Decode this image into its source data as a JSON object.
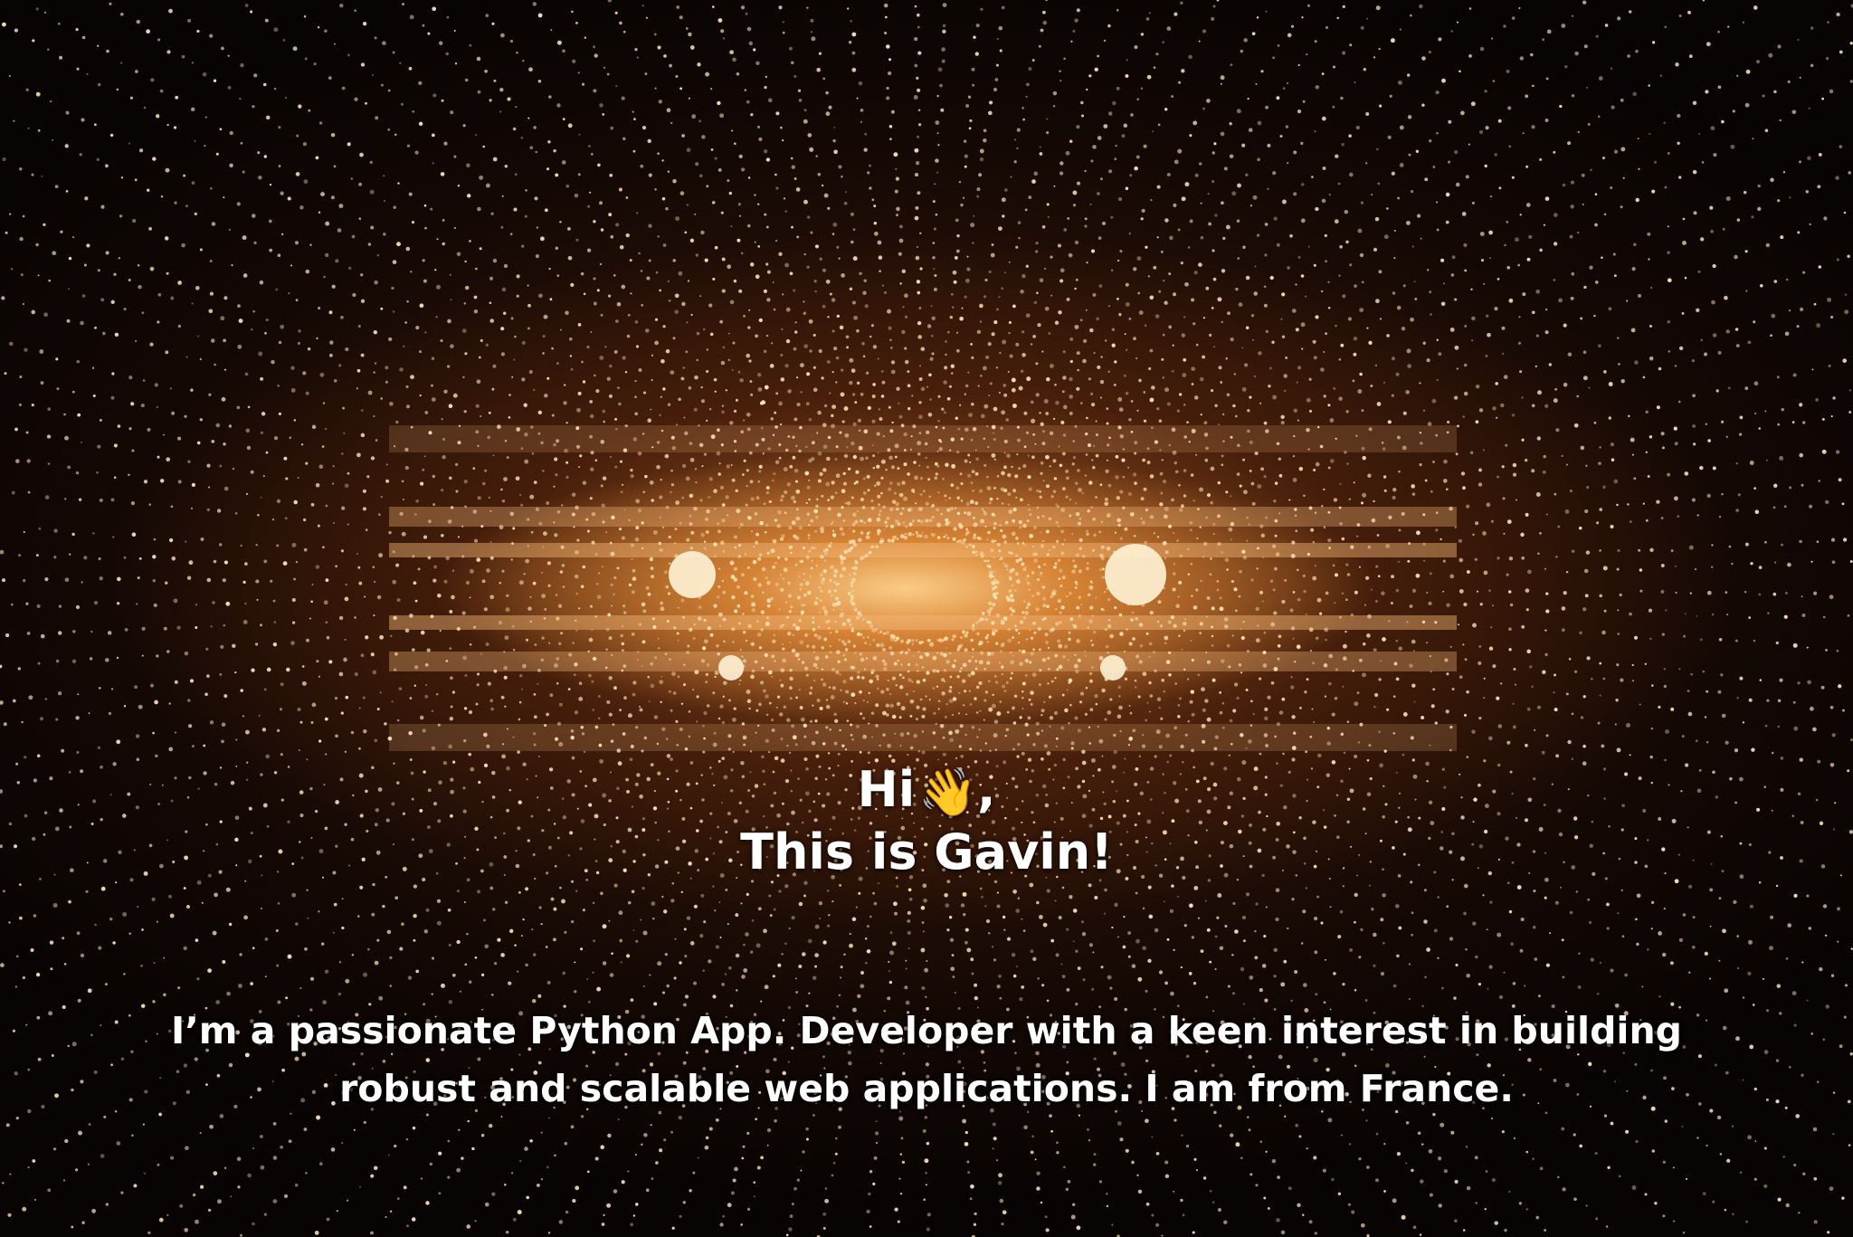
{
  "hero": {
    "greeting_prefix": "Hi",
    "wave_emoji": "👋",
    "greeting_suffix": ",",
    "name_line": "This is Gavin!",
    "intro_line_1": "I’m a passionate Python App. Developer with a keen interest in building",
    "intro_line_2": "robust and scalable web applications. I am from France.",
    "background_icon": "string-lights-atrium",
    "colors": {
      "text": "#ffffff",
      "glow": "#ffcf8a",
      "dark": "#0a0604"
    }
  }
}
